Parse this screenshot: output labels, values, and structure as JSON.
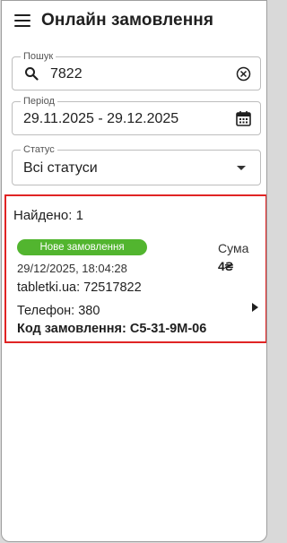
{
  "header": {
    "title": "Онлайн замовлення",
    "menu_icon": "hamburger-menu-icon"
  },
  "search": {
    "label": "Пошук",
    "value": "7822",
    "icon": "search-icon",
    "clear_icon": "clear-circle-icon"
  },
  "period": {
    "label": "Період",
    "value": "29.11.2025 - 29.12.2025",
    "icon": "calendar-icon"
  },
  "status": {
    "label": "Статус",
    "value": "Всі статуси",
    "icon": "dropdown-arrow-icon"
  },
  "results": {
    "found_text": "Найдено: 1",
    "orders": [
      {
        "status_badge": "Нове замовлення",
        "status_color": "#52b52f",
        "datetime": "29/12/2025, 18:04:28",
        "source": "tabletki.ua: 72517822",
        "sum_label": "Сума",
        "sum_value": "4₴",
        "phone": "Телефон: 380",
        "order_code": "Код замовлення: C5-31-9M-06"
      }
    ]
  },
  "colors": {
    "highlight_border": "#e02424",
    "badge_green": "#52b52f"
  }
}
